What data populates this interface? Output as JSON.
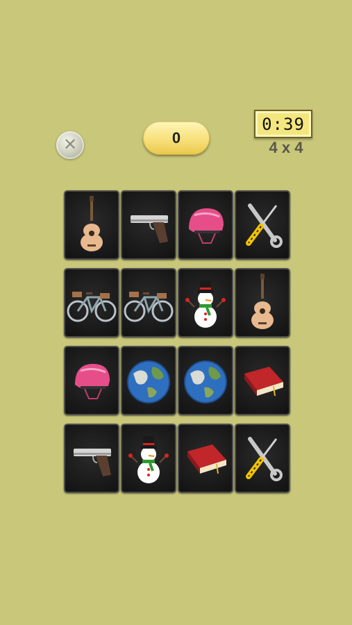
{
  "close_button": {
    "icon": "close-icon"
  },
  "score": {
    "value": "0"
  },
  "timer": {
    "value": "0:39"
  },
  "grid_size": {
    "label": "4 x 4"
  },
  "cards": [
    {
      "icon": "guitar-icon"
    },
    {
      "icon": "pistol-icon"
    },
    {
      "icon": "helmet-icon"
    },
    {
      "icon": "tools-icon"
    },
    {
      "icon": "bicycle-icon"
    },
    {
      "icon": "bicycle-icon"
    },
    {
      "icon": "snowman-icon"
    },
    {
      "icon": "guitar-icon"
    },
    {
      "icon": "helmet-icon"
    },
    {
      "icon": "globe-icon"
    },
    {
      "icon": "globe-icon"
    },
    {
      "icon": "book-icon"
    },
    {
      "icon": "pistol-icon"
    },
    {
      "icon": "snowman-icon"
    },
    {
      "icon": "book-icon"
    },
    {
      "icon": "tools-icon"
    }
  ]
}
